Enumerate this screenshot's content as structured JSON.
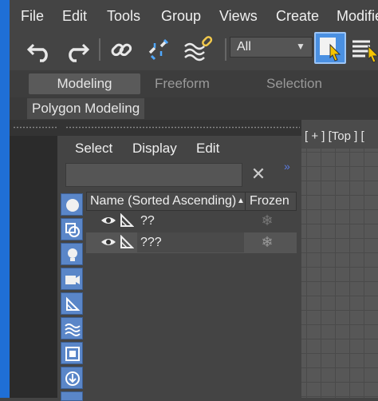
{
  "menubar": {
    "items": [
      "File",
      "Edit",
      "Tools",
      "Group",
      "Views",
      "Create",
      "Modifie"
    ]
  },
  "toolbar": {
    "selection_filter": "All",
    "icons": [
      "undo-icon",
      "redo-icon",
      "link-icon",
      "unlink-icon",
      "bind-space-warp-icon",
      "select-object-icon",
      "select-by-name-icon"
    ]
  },
  "ribbon": {
    "tabs": [
      "Modeling",
      "Freeform",
      "Selection"
    ],
    "active_tab": "Modeling",
    "panel_tab": "Polygon Modeling"
  },
  "scene_explorer": {
    "menu": [
      "Select",
      "Display",
      "Edit"
    ],
    "search_placeholder": "",
    "columns": {
      "name": "Name (Sorted Ascending)",
      "sort_indicator": "▲",
      "frozen": "Frozen"
    },
    "rows": [
      {
        "name": "??",
        "frozen_icon": "snowflake-icon"
      },
      {
        "name": "???",
        "frozen_icon": "snowflake-icon"
      }
    ],
    "filter_icons": [
      "geometry-filter-icon",
      "shapes-filter-icon",
      "lights-filter-icon",
      "cameras-filter-icon",
      "helpers-filter-icon",
      "spacewarps-filter-icon",
      "groups-filter-icon",
      "xrefs-filter-icon",
      "bones-filter-icon"
    ]
  },
  "viewport": {
    "label": "[ + ] [Top ] ["
  },
  "colors": {
    "window_edge": "#1f6fd6",
    "filter_button": "#5a86c8",
    "active_tool": "#4a90e2"
  }
}
